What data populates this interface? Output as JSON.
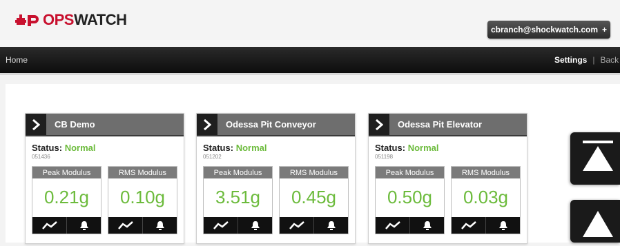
{
  "app": {
    "logo_main": "OPS",
    "logo_watch": "WATCH",
    "brand_color": "#c8102e",
    "status_color": "#6cbb3c"
  },
  "header": {
    "user_email": "cbranch@shockwatch.com",
    "user_plus": "+"
  },
  "nav": {
    "home": "Home",
    "settings": "Settings",
    "separator": "|",
    "back": "Back"
  },
  "status_label": "Status:",
  "cards": [
    {
      "title": "CB Demo",
      "status": "Normal",
      "serial": "051436",
      "metrics": [
        {
          "label": "Peak Modulus",
          "value": "0.21g"
        },
        {
          "label": "RMS Modulus",
          "value": "0.10g"
        }
      ]
    },
    {
      "title": "Odessa Pit Conveyor",
      "status": "Normal",
      "serial": "051202",
      "metrics": [
        {
          "label": "Peak Modulus",
          "value": "3.51g"
        },
        {
          "label": "RMS Modulus",
          "value": "0.45g"
        }
      ]
    },
    {
      "title": "Odessa Pit Elevator",
      "status": "Normal",
      "serial": "051198",
      "metrics": [
        {
          "label": "Peak Modulus",
          "value": "0.50g"
        },
        {
          "label": "RMS Modulus",
          "value": "0.03g"
        }
      ]
    }
  ],
  "icons": {
    "card_open": "chevron-right-icon",
    "trend": "trend-line-icon",
    "alarm": "bell-icon",
    "scroll_top": "scroll-to-top-icon",
    "scroll_up": "scroll-up-icon"
  }
}
